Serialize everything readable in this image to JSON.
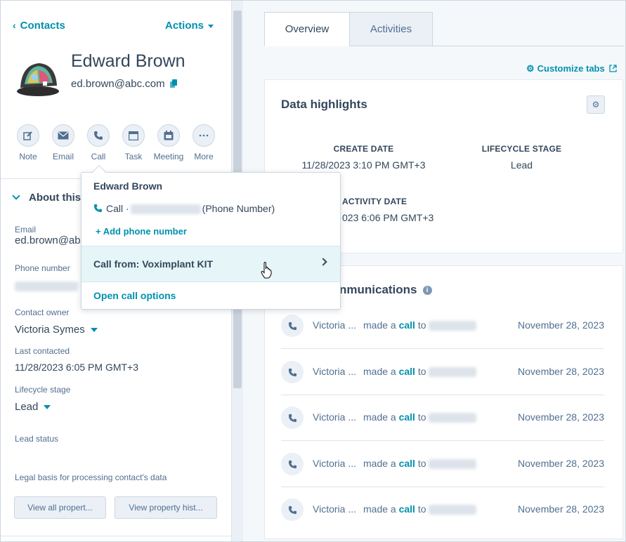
{
  "header": {
    "back_label": "Contacts",
    "actions_label": "Actions"
  },
  "contact": {
    "name": "Edward Brown",
    "email": "ed.brown@abc.com"
  },
  "quick_actions": [
    {
      "label": "Note",
      "icon": "edit-icon"
    },
    {
      "label": "Email",
      "icon": "envelope-icon"
    },
    {
      "label": "Call",
      "icon": "phone-icon"
    },
    {
      "label": "Task",
      "icon": "task-icon"
    },
    {
      "label": "Meeting",
      "icon": "calendar-icon"
    },
    {
      "label": "More",
      "icon": "more-icon"
    }
  ],
  "about": {
    "title": "About this",
    "email_label": "Email",
    "email_value": "ed.brown@abc",
    "phone_label": "Phone number",
    "owner_label": "Contact owner",
    "owner_value": "Victoria Symes",
    "last_contacted_label": "Last contacted",
    "last_contacted_value": "11/28/2023 6:05 PM GMT+3",
    "lifecycle_label": "Lifecycle stage",
    "lifecycle_value": "Lead",
    "lead_status_label": "Lead status",
    "legal_label": "Legal basis for processing contact's data",
    "view_all_label": "View all propert...",
    "view_history_label": "View property hist..."
  },
  "tabs": [
    {
      "label": "Overview"
    },
    {
      "label": "Activities"
    }
  ],
  "customize_label": "Customize tabs",
  "highlights": {
    "title": "Data highlights",
    "create_date_label": "CREATE DATE",
    "create_date_value": "11/28/2023 3:10 PM GMT+3",
    "lifecycle_label": "LIFECYCLE STAGE",
    "lifecycle_value": "Lead",
    "activity_label": "ACTIVITY DATE",
    "activity_value": "023 6:06 PM GMT+3"
  },
  "communications": {
    "title": "nmunications",
    "rows": [
      {
        "who": "Victoria ...",
        "verb": "made a",
        "link": "call",
        "to": "to",
        "date": "November 28, 2023"
      },
      {
        "who": "Victoria ...",
        "verb": "made a",
        "link": "call",
        "to": "to",
        "date": "November 28, 2023"
      },
      {
        "who": "Victoria ...",
        "verb": "made a",
        "link": "call",
        "to": "to",
        "date": "November 28, 2023"
      },
      {
        "who": "Victoria ...",
        "verb": "made a",
        "link": "call",
        "to": "to",
        "date": "November 28, 2023"
      },
      {
        "who": "Victoria ...",
        "verb": "made a",
        "link": "call",
        "to": "to",
        "date": "November 28, 2023"
      }
    ]
  },
  "popover": {
    "name": "Edward Brown",
    "call_prefix": "Call ·",
    "call_suffix": "(Phone Number)",
    "add_phone": "+ Add phone number",
    "call_from": "Call from: Voximplant KIT",
    "open_options": "Open call options"
  },
  "colors": {
    "accent": "#0091ae",
    "text": "#33475b",
    "muted": "#516f90",
    "highlight": "#e5f5f8"
  }
}
